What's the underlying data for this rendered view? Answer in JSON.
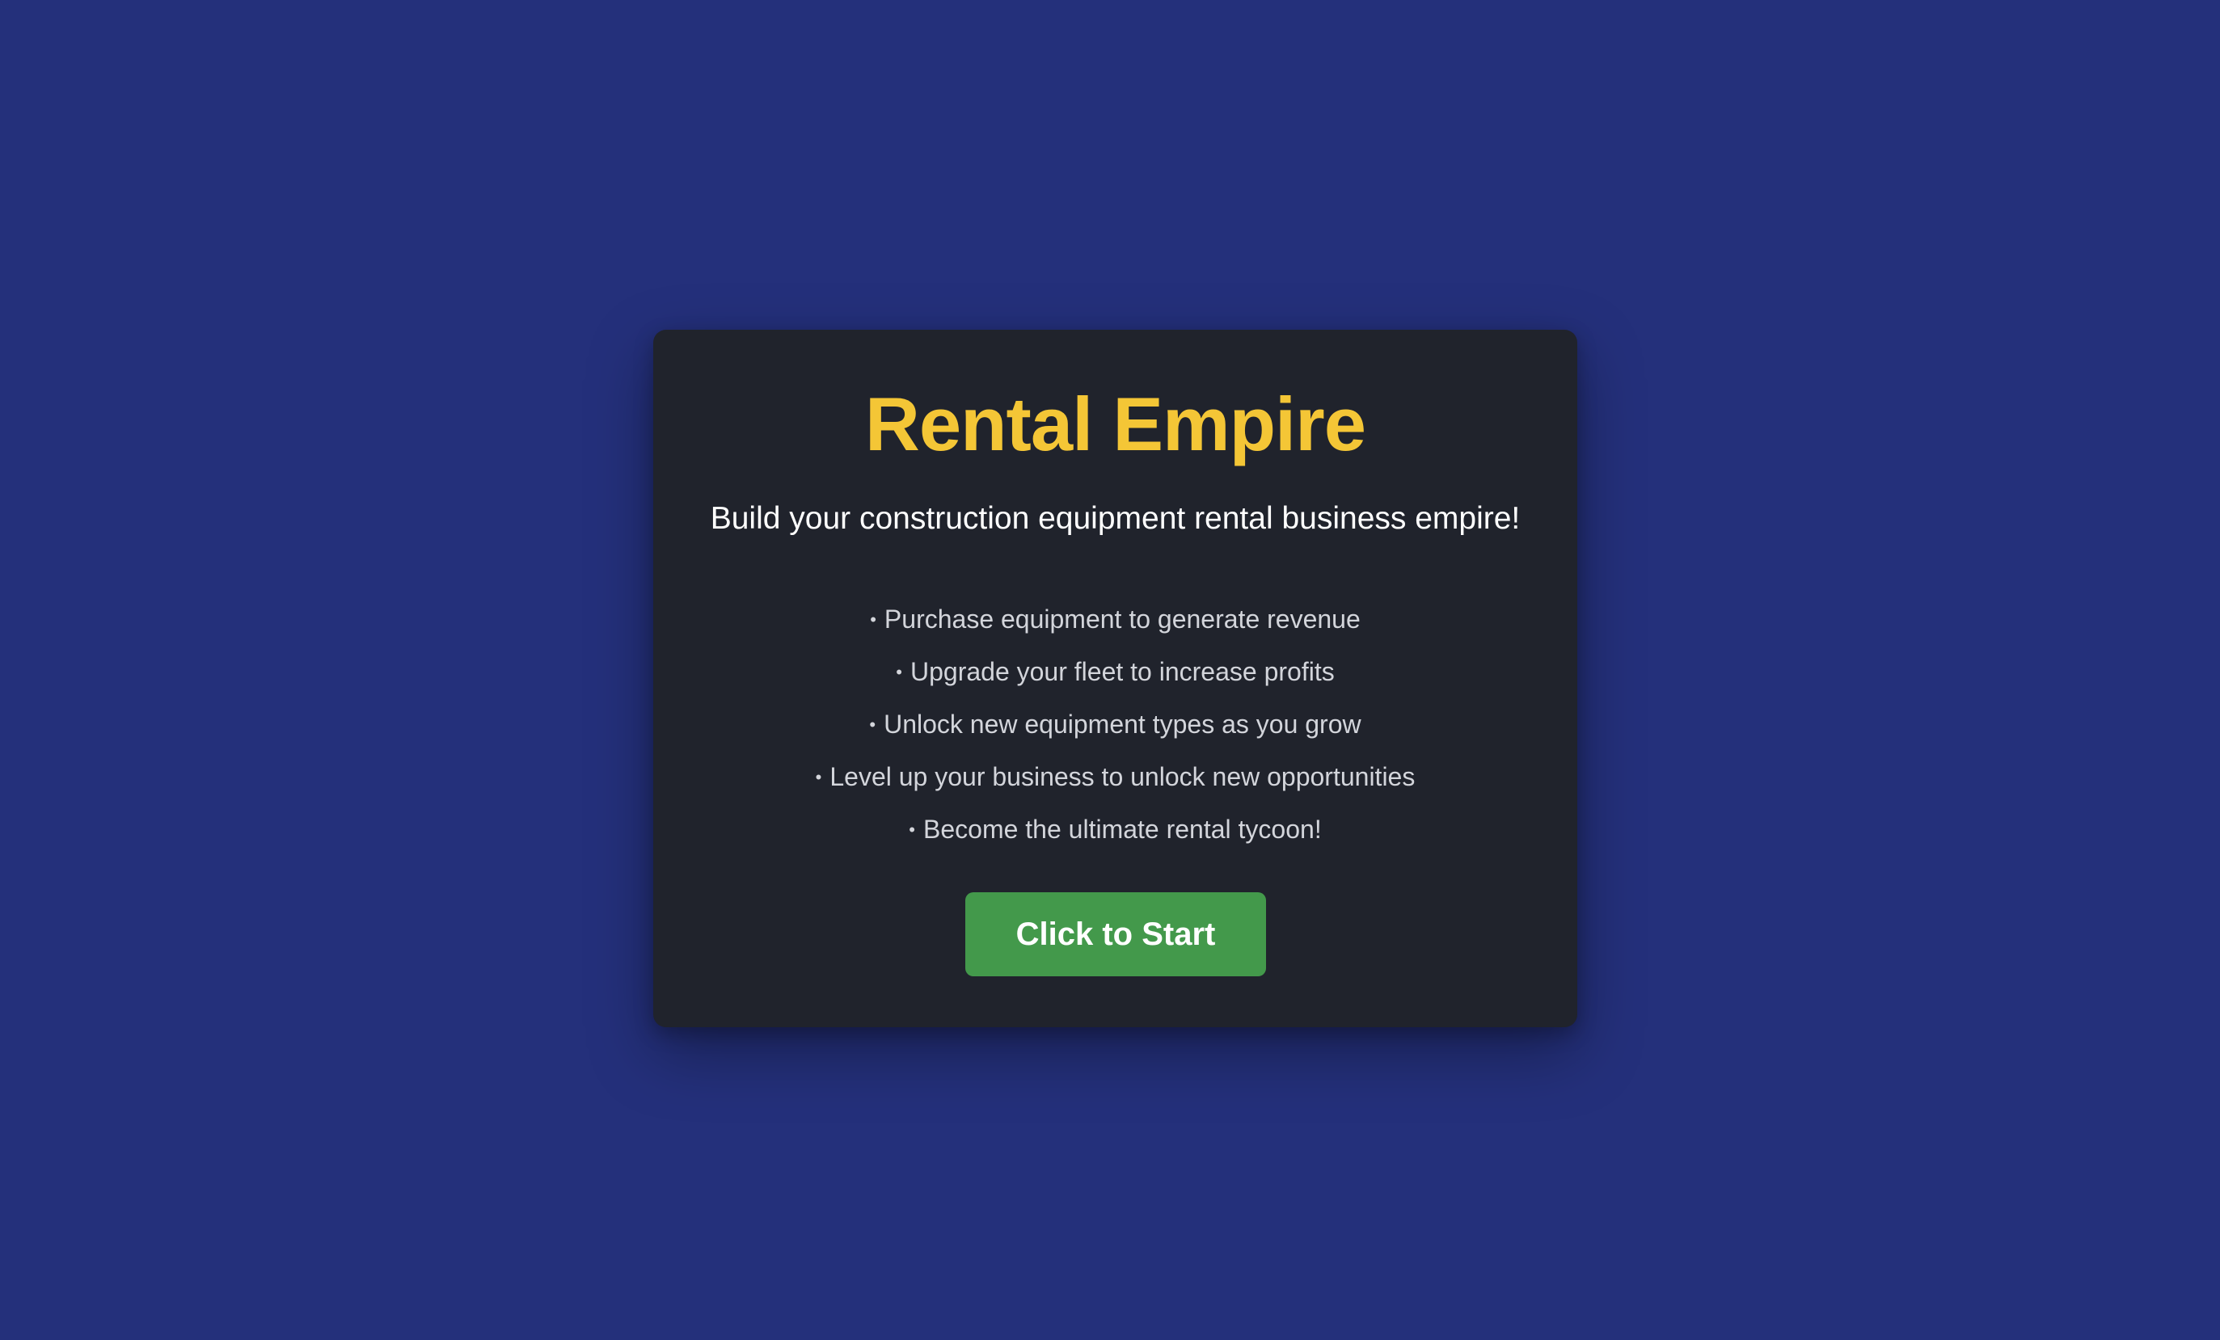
{
  "game": {
    "title": "Rental Empire",
    "subtitle": "Build your construction equipment rental business empire!",
    "features": [
      "Purchase equipment to generate revenue",
      "Upgrade your fleet to increase profits",
      "Unlock new equipment types as you grow",
      "Level up your business to unlock new opportunities",
      "Become the ultimate rental tycoon!"
    ],
    "bullet_symbol": "•",
    "start_label": "Click to Start"
  },
  "colors": {
    "background": "#24307b",
    "card": "#20232c",
    "title": "#f4c636",
    "button": "#43994b",
    "feature_text": "#d3d5db"
  }
}
